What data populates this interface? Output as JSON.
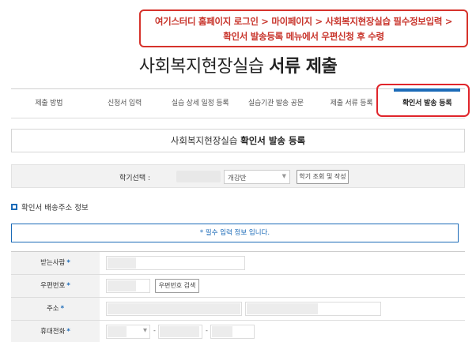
{
  "callout": {
    "line1": "여기스터디 홈페이지 로그인 > 마이페이지 > 사회복지현장실습 필수정보입력 >",
    "line2": "확인서 발송등록 메뉴에서 우편신청 후 수령"
  },
  "page_title": {
    "normal": "사회복지현장실습 ",
    "bold": "서류 제출"
  },
  "tabs": [
    {
      "label": "제출 방법",
      "active": false
    },
    {
      "label": "신청서 입력",
      "active": false
    },
    {
      "label": "실습 상세 일정 등록",
      "active": false
    },
    {
      "label": "실습기관 발송 공문",
      "active": false
    },
    {
      "label": "제출 서류 등록",
      "active": false
    },
    {
      "label": "확인서 발송 등록",
      "active": true
    }
  ],
  "subtitle": {
    "normal": "사회복지현장실습 ",
    "bold": "확인서 발송 등록"
  },
  "semester": {
    "label": "학기선택 :",
    "select_value": "개강반",
    "button": "학기 조회 및 작성"
  },
  "section_title": "확인서 배송주소 정보",
  "notice": "* 필수 입력 정보 입니다.",
  "form": {
    "recipient_label": "받는사람",
    "postcode_label": "우편번호",
    "postcode_button": "우편번호 검색",
    "address_label": "주소",
    "phone_label": "휴대전화",
    "required_mark": "*",
    "phone_dash": "-"
  },
  "colors": {
    "accent": "#1c6bb8",
    "callout_red": "#d6332c"
  }
}
